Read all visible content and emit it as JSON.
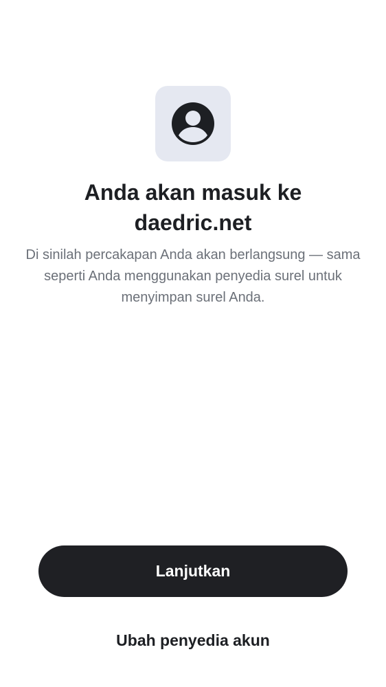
{
  "header": {
    "avatar_icon": "user-circle-icon",
    "avatar_background": "#e5e8f1",
    "avatar_color": "#1d1f23"
  },
  "content": {
    "title": "Anda akan masuk ke daedric.net",
    "description": "Di sinilah percakapan Anda akan berlangsung — sama seperti Anda menggunakan penyedia surel untuk menyimpan surel Anda."
  },
  "actions": {
    "continue_label": "Lanjutkan",
    "change_provider_label": "Ubah penyedia akun",
    "primary_color": "#1f2024"
  }
}
